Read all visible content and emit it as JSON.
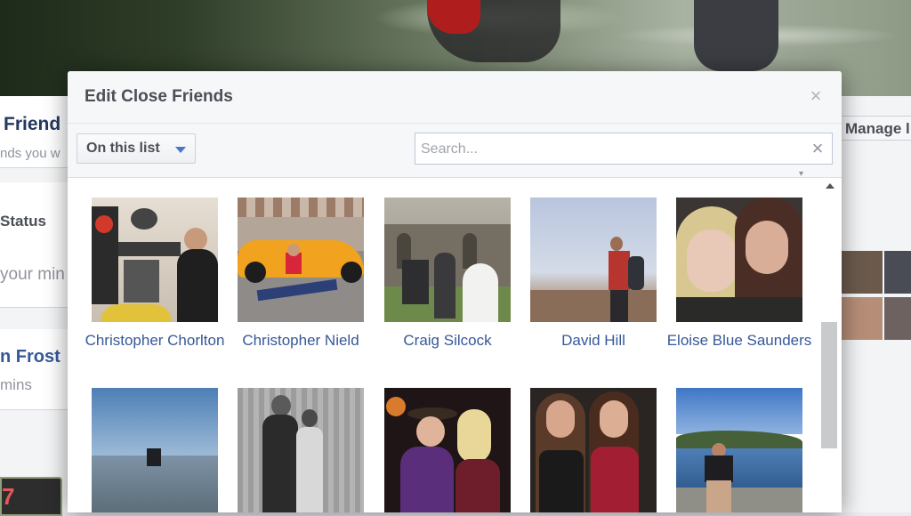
{
  "background": {
    "friends_title": "Friend",
    "friends_sub": "nds you w",
    "status": "Status",
    "mind": "your min",
    "frost": "n Frost",
    "mins": "mins",
    "badge": "7",
    "manage": "Manage l"
  },
  "modal": {
    "title": "Edit Close Friends",
    "close_icon": "×",
    "dropdown_label": "On this list",
    "search_placeholder": "Search...",
    "search_clear_icon": "×"
  },
  "friends": [
    {
      "name": "Christopher Chorlton"
    },
    {
      "name": "Christopher Nield"
    },
    {
      "name": "Craig Silcock"
    },
    {
      "name": "David Hill"
    },
    {
      "name": "Eloise Blue Saunders"
    },
    {
      "name": ""
    },
    {
      "name": ""
    },
    {
      "name": ""
    },
    {
      "name": ""
    },
    {
      "name": ""
    }
  ],
  "colors": {
    "link": "#365899",
    "header_bg": "#f6f7f9",
    "caret": "#4a76c8"
  }
}
